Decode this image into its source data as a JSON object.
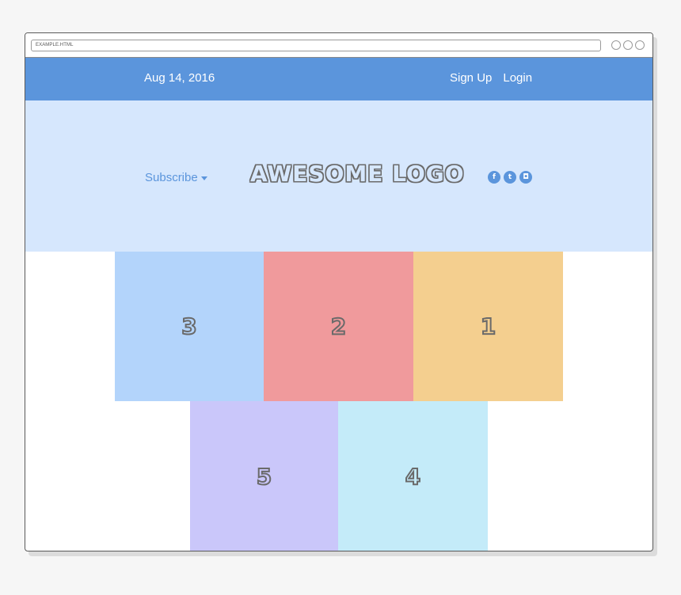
{
  "browser": {
    "url": "EXAMPLE.HTML"
  },
  "header": {
    "date": "Aug 14, 2016",
    "signup_label": "Sign Up",
    "login_label": "Login"
  },
  "hero": {
    "subscribe_label": "Subscribe",
    "logo_text": "AWESOME LOGO",
    "social": {
      "facebook": "f",
      "twitter": "t",
      "instagram": "◘"
    }
  },
  "tiles": [
    "3",
    "2",
    "1",
    "5",
    "4"
  ],
  "colors": {
    "accent": "#5b95dc",
    "hero_bg": "#d6e7fd",
    "tile_3": "#b3d4fb",
    "tile_2": "#f09a9c",
    "tile_1": "#f4cf8f",
    "tile_5": "#cac7fa",
    "tile_4": "#c4ebf9"
  }
}
